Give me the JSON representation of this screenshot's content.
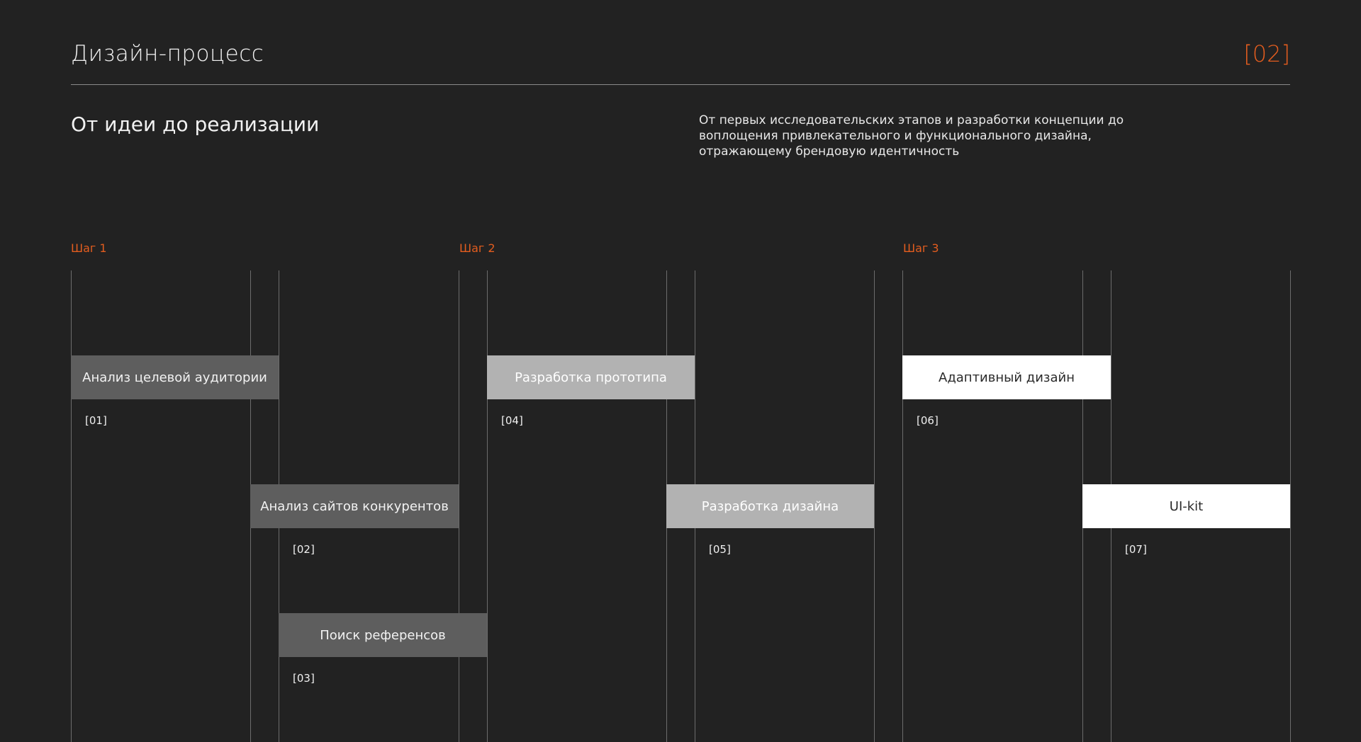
{
  "header": {
    "title": "Дизайн-процесс",
    "page_number": "[02]"
  },
  "intro": {
    "subtitle": "От идеи до реализации",
    "description": "От первых исследовательских этапов и разработки концепции до воплощения привлекательного и функционального дизайна, отражающему брендовую идентичность"
  },
  "steps": [
    {
      "label": "Шаг 1"
    },
    {
      "label": "Шаг 2"
    },
    {
      "label": "Шаг 3"
    }
  ],
  "tasks": [
    {
      "label": "Анализ целевой аудитории",
      "number": "[01]",
      "step": 1,
      "shade": "dark"
    },
    {
      "label": "Анализ сайтов конкурентов",
      "number": "[02]",
      "step": 1,
      "shade": "dark"
    },
    {
      "label": "Поиск референсов",
      "number": "[03]",
      "step": 1,
      "shade": "dark"
    },
    {
      "label": "Разработка прототипа",
      "number": "[04]",
      "step": 2,
      "shade": "mid"
    },
    {
      "label": "Разработка дизайна",
      "number": "[05]",
      "step": 2,
      "shade": "mid"
    },
    {
      "label": "Адаптивный дизайн",
      "number": "[06]",
      "step": 3,
      "shade": "light"
    },
    {
      "label": "UI-kit",
      "number": "[07]",
      "step": 3,
      "shade": "light"
    }
  ],
  "colors": {
    "background": "#222222",
    "accent": "#e35d1f",
    "shade_dark": "#5e5e5e",
    "shade_mid": "#b2b2b2",
    "shade_light": "#ffffff"
  }
}
